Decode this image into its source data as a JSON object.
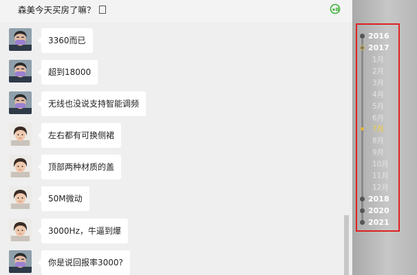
{
  "header": {
    "title": "森美今天买房了嘛？"
  },
  "messages": [
    {
      "text": "3360而已",
      "avatar": "masked-person"
    },
    {
      "text": "超到18000",
      "avatar": "masked-person"
    },
    {
      "text": "无线也没说支持智能调频",
      "avatar": "masked-person"
    },
    {
      "text": "左右都有可换侧裙",
      "avatar": "child-person"
    },
    {
      "text": "顶部两种材质的盖",
      "avatar": "child-person"
    },
    {
      "text": "50M微动",
      "avatar": "child-person"
    },
    {
      "text": "3000Hz，牛逼到爆",
      "avatar": "child-person"
    },
    {
      "text": "你是说回报率3000?",
      "avatar": "masked-person"
    }
  ],
  "timeline": {
    "items": [
      {
        "label": "2016",
        "kind": "year"
      },
      {
        "label": "2017",
        "kind": "year-active"
      },
      {
        "label": "1月",
        "kind": "month"
      },
      {
        "label": "2月",
        "kind": "month"
      },
      {
        "label": "3月",
        "kind": "month"
      },
      {
        "label": "4月",
        "kind": "month"
      },
      {
        "label": "5月",
        "kind": "month"
      },
      {
        "label": "6月",
        "kind": "month"
      },
      {
        "label": "7月",
        "kind": "month-active"
      },
      {
        "label": "8月",
        "kind": "month"
      },
      {
        "label": "9月",
        "kind": "month"
      },
      {
        "label": "10月",
        "kind": "month"
      },
      {
        "label": "11月",
        "kind": "month"
      },
      {
        "label": "12月",
        "kind": "month"
      },
      {
        "label": "2018",
        "kind": "year"
      },
      {
        "label": "2020",
        "kind": "year"
      },
      {
        "label": "2021",
        "kind": "year"
      }
    ],
    "highlight_color": "#e02020",
    "active_color": "#f3d040"
  },
  "colors": {
    "chat_background": "#efefef",
    "bubble": "#ffffff",
    "header_icon": "#3cb034"
  }
}
